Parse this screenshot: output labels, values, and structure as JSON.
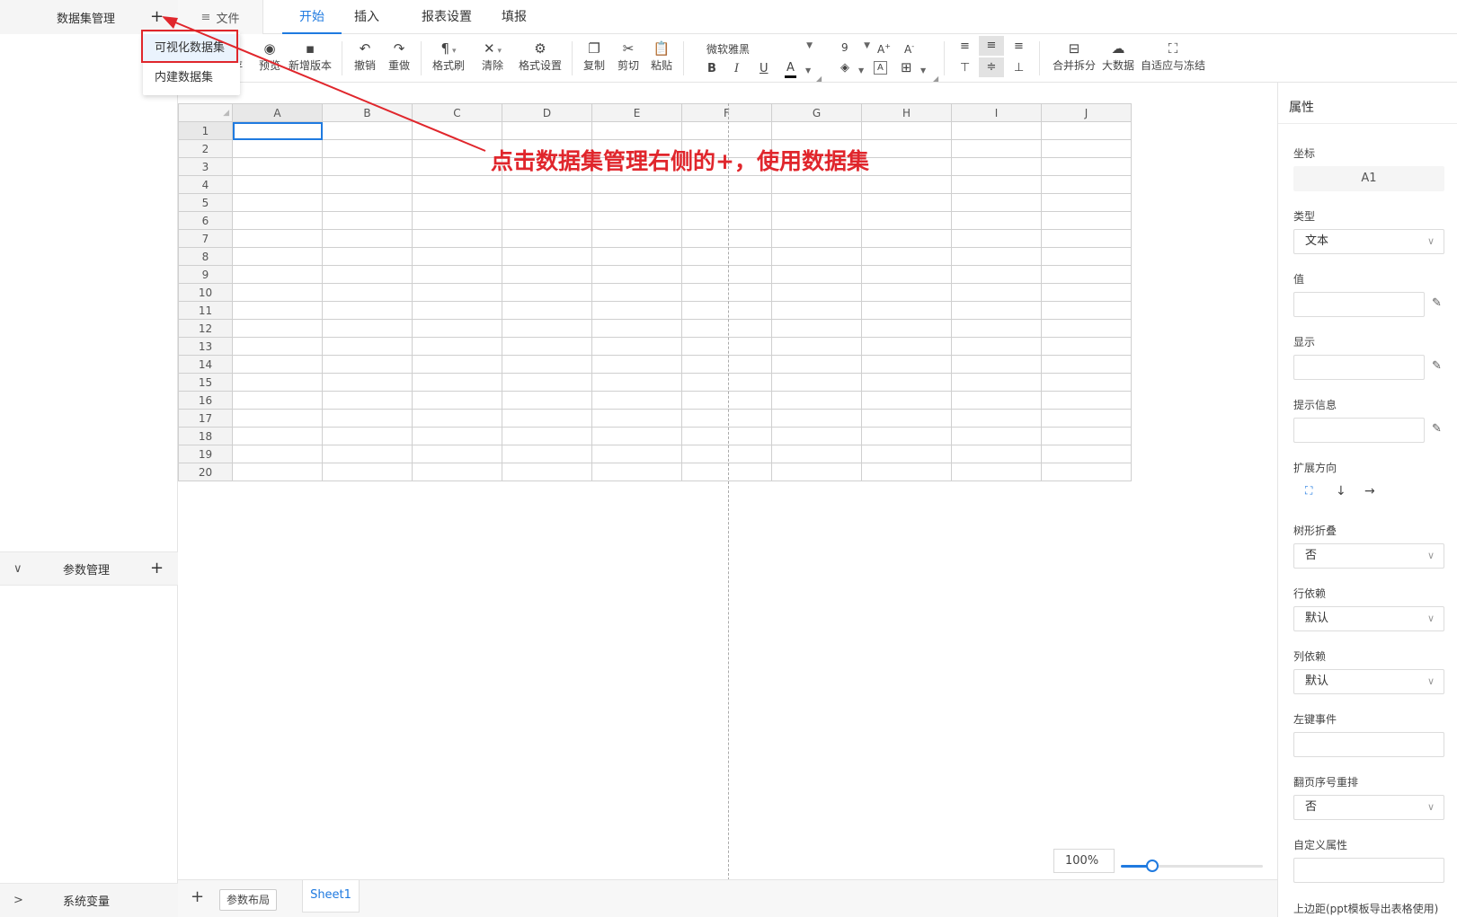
{
  "sidebar": {
    "dataset_title": "数据集管理",
    "param_title": "参数管理",
    "sysvar_title": "系统变量",
    "plus": "+",
    "chev_down": "∨",
    "chev_right": ">"
  },
  "dataset_menu": {
    "items": [
      "可视化数据集",
      "内建数据集"
    ]
  },
  "topbar": {
    "file_label": "文件",
    "tabs": [
      "开始",
      "插入",
      "报表设置",
      "填报"
    ]
  },
  "toolbar": {
    "save_partial": "存",
    "preview": "预览",
    "new_version": "新增版本",
    "undo": "撤销",
    "redo": "重做",
    "format_painter": "格式刷",
    "clear": "清除",
    "format_settings": "格式设置",
    "copy": "复制",
    "cut": "剪切",
    "paste": "粘贴",
    "font_family": "微软雅黑",
    "font_size": "9",
    "merge_split": "合并拆分",
    "big_data": "大数据",
    "autofit_freeze": "自适应与冻结"
  },
  "sheet": {
    "cell_ref": "A1",
    "columns": [
      "A",
      "B",
      "C",
      "D",
      "E",
      "F",
      "G",
      "H",
      "I",
      "J"
    ],
    "rows": [
      "1",
      "2",
      "3",
      "4",
      "5",
      "6",
      "7",
      "8",
      "9",
      "10",
      "11",
      "12",
      "13",
      "14",
      "15",
      "16",
      "17",
      "18",
      "19",
      "20"
    ]
  },
  "bottombar": {
    "add": "+",
    "param_layout": "参数布局",
    "sheet_name": "Sheet1",
    "zoom_value": "100%",
    "zoom_slider_fraction": 0.22
  },
  "properties": {
    "title": "属性",
    "coord_label": "坐标",
    "coord_value": "A1",
    "type_label": "类型",
    "type_value": "文本",
    "value_label": "值",
    "display_label": "显示",
    "tooltip_label": "提示信息",
    "expand_label": "扩展方向",
    "tree_fold_label": "树形折叠",
    "tree_fold_value": "否",
    "row_dep_label": "行依赖",
    "row_dep_value": "默认",
    "col_dep_label": "列依赖",
    "col_dep_value": "默认",
    "left_click_label": "左键事件",
    "page_reorder_label": "翻页序号重排",
    "page_reorder_value": "否",
    "custom_attr_label": "自定义属性",
    "top_margin_label": "上边距(ppt模板导出表格使用)"
  },
  "annotation": {
    "text": "点击数据集管理右侧的+，使用数据集",
    "color": "#e0262c"
  },
  "colors": {
    "accent": "#1f7ae0",
    "annotation_red": "#e0262c"
  }
}
